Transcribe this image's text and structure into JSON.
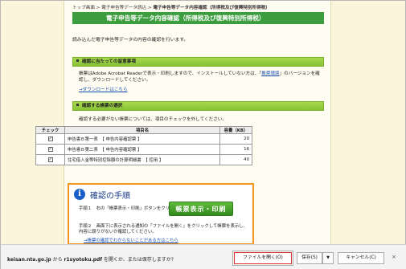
{
  "breadcrumb": {
    "items": [
      "トップ画面",
      "電子申告等データ読込"
    ],
    "sep": ">",
    "current": "電子申告等データ内容確認（所得税及び復興特別所得税）"
  },
  "page_title": "電子申告等データ内容確認（所得税及び復興特別所得税）",
  "intro": "読み込んだ電子申告等データの内容の確認を行います。",
  "section1": {
    "heading": "確認に当たっての留意事項",
    "text_before": "帳票はAdobe Acrobat Readerで表示・印刷しますので、インストールしていない方は、「",
    "link": "推奨環境",
    "text_after": "」のバージョンを確認し、ダウンロードしてください。",
    "download_link": "→ダウンロードはこちら"
  },
  "section2": {
    "heading": "確認する帳票の選択",
    "text": "確認する必要がない帳票については、項目のチェックを外してください。"
  },
  "table": {
    "headers": [
      "チェック",
      "項目名",
      "容量（KB）"
    ],
    "rows": [
      {
        "checked": "✓",
        "name": "申告書Ｂ第一表　【 申告内容確認票 】",
        "size": "20"
      },
      {
        "checked": "✓",
        "name": "申告書Ｂ第二表　【 申告内容確認票 】",
        "size": "16"
      },
      {
        "checked": "✓",
        "name": "住宅借入金等特別控除額の計算明細書　【 控用 】",
        "size": "40"
      }
    ]
  },
  "confirm_box": {
    "icon": "info-icon",
    "title": "確認の手順",
    "step1": "手順１　右の「帳票表示・印刷」ボタンをクリックしてください。",
    "step2": "手順２　画面下に表示される通知の「ファイルを開く」をクリックして帳票を表示し、内容に誤りがないか確認してください。",
    "link": "→帳票の確認でわからないことがある方はこちら",
    "print_button": "帳票表示・印刷"
  },
  "download_bar": {
    "domain": "keisan.nta.go.jp",
    "mid1": " から ",
    "filename": "r1syotoku.pdf",
    "mid2": " を開くか、または保存しますか?",
    "open_label": "ファイルを開く(O)",
    "save_label": "保存(S)",
    "save_dropdown": "▼",
    "cancel_label": "キャンセル(C)",
    "close_glyph": "×"
  },
  "colors": {
    "title_bar": "#3b9d3d",
    "section_bar": "#99cc44",
    "box_border": "#f2961c",
    "print_button": "#3d9a28",
    "link": "#1a4fb0"
  }
}
